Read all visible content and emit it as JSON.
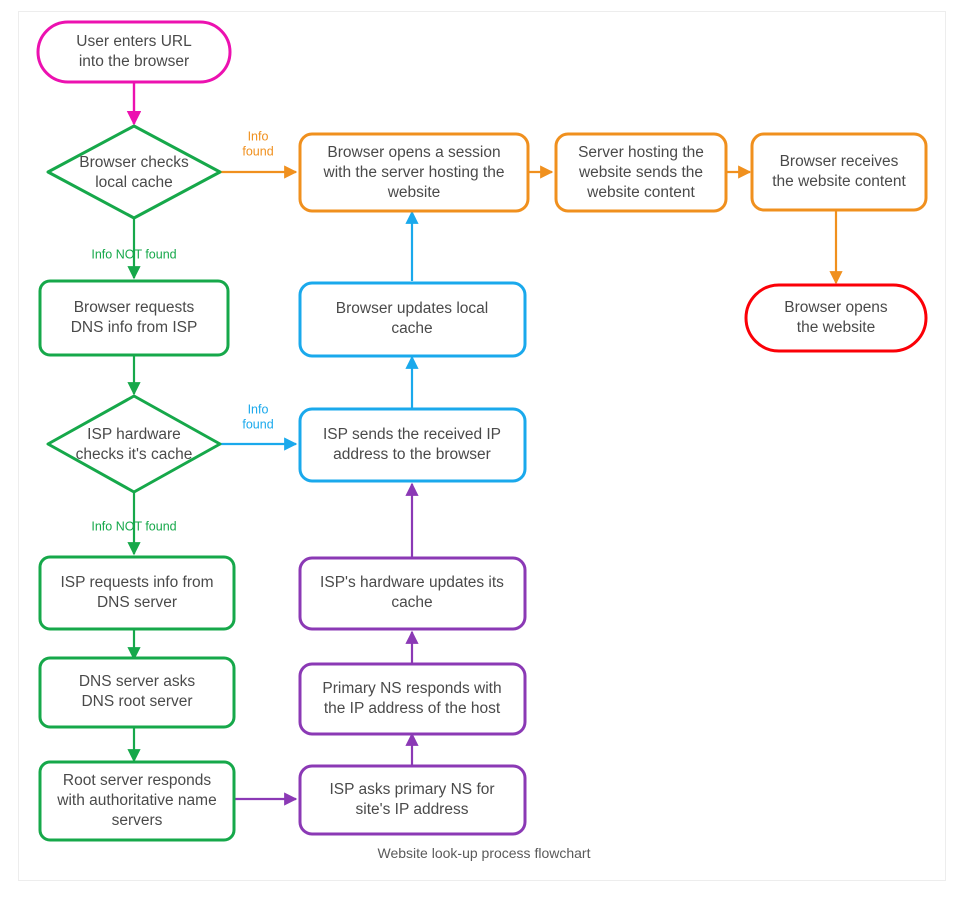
{
  "caption": "Website look-up process flowchart",
  "colors": {
    "start_pink": "#ec11b0",
    "decision_green": "#16a84a",
    "process_green": "#16a84a",
    "orange": "#f0901e",
    "blue": "#1aa9ec",
    "purple": "#8b39b5",
    "red": "#fb0007",
    "text": "#4a4a4a",
    "frame_border": "#ededed",
    "background": "#ffffff"
  },
  "nodes": [
    {
      "id": "start",
      "shape": "stadium",
      "color": "start_pink",
      "lines": [
        "User enters URL",
        "into the browser"
      ]
    },
    {
      "id": "browser-cache",
      "shape": "diamond",
      "color": "decision_green",
      "lines": [
        "Browser checks",
        "local cache"
      ]
    },
    {
      "id": "browser-dns",
      "shape": "rect",
      "color": "process_green",
      "lines": [
        "Browser requests",
        "DNS info from ISP"
      ]
    },
    {
      "id": "isp-cache",
      "shape": "diamond",
      "color": "decision_green",
      "lines": [
        "ISP hardware",
        "checks it's cache"
      ]
    },
    {
      "id": "isp-requests",
      "shape": "rect",
      "color": "process_green",
      "lines": [
        "ISP requests info from",
        "DNS server"
      ]
    },
    {
      "id": "dns-asks-root",
      "shape": "rect",
      "color": "process_green",
      "lines": [
        "DNS server asks",
        "DNS root server"
      ]
    },
    {
      "id": "root-responds",
      "shape": "rect",
      "color": "process_green",
      "lines": [
        "Root server responds",
        "with authoritative name",
        "servers"
      ]
    },
    {
      "id": "isp-asks-ns",
      "shape": "rect",
      "color": "purple",
      "lines": [
        "ISP asks primary NS for",
        "site's IP address"
      ]
    },
    {
      "id": "ns-responds",
      "shape": "rect",
      "color": "purple",
      "lines": [
        "Primary NS responds with",
        "the IP address of the host"
      ]
    },
    {
      "id": "isp-updates",
      "shape": "rect",
      "color": "purple",
      "lines": [
        "ISP's hardware updates its",
        "cache"
      ]
    },
    {
      "id": "isp-sends-ip",
      "shape": "rect",
      "color": "blue",
      "lines": [
        "ISP sends the received IP",
        "address to the browser"
      ]
    },
    {
      "id": "browser-updates",
      "shape": "rect",
      "color": "blue",
      "lines": [
        "Browser updates local",
        "cache"
      ]
    },
    {
      "id": "browser-session",
      "shape": "rect",
      "color": "orange",
      "lines": [
        "Browser opens a session",
        "with the server hosting the",
        "website"
      ]
    },
    {
      "id": "server-sends",
      "shape": "rect",
      "color": "orange",
      "lines": [
        "Server hosting the",
        "website sends the",
        "website content"
      ]
    },
    {
      "id": "browser-receives",
      "shape": "rect",
      "color": "orange",
      "lines": [
        "Browser receives",
        "the website content"
      ]
    },
    {
      "id": "browser-opens",
      "shape": "stadium",
      "color": "red",
      "lines": [
        "Browser opens",
        "the website"
      ]
    }
  ],
  "edges": [
    {
      "id": "start-to-cache",
      "color": "start_pink",
      "label": ""
    },
    {
      "id": "cache-found-to-session",
      "color": "orange",
      "label": "Info\nfound",
      "label_lines": [
        "Info",
        "found"
      ]
    },
    {
      "id": "cache-notfound-to-dns",
      "color": "process_green",
      "label": "Info NOT found",
      "label_lines": [
        "Info NOT found"
      ]
    },
    {
      "id": "dns-to-ispcache",
      "color": "process_green",
      "label": ""
    },
    {
      "id": "ispcache-found-to-sendsip",
      "color": "blue",
      "label": "Info\nfound",
      "label_lines": [
        "Info",
        "found"
      ]
    },
    {
      "id": "ispcache-notfound-to-isprequests",
      "color": "process_green",
      "label": "Info NOT found",
      "label_lines": [
        "Info NOT found"
      ]
    },
    {
      "id": "isprequests-to-dnsasks",
      "color": "process_green",
      "label": ""
    },
    {
      "id": "dnsasks-to-rootresponds",
      "color": "process_green",
      "label": ""
    },
    {
      "id": "rootresponds-to-ispasksns",
      "color": "purple",
      "label": ""
    },
    {
      "id": "ispasksns-to-nsresponds",
      "color": "purple",
      "label": ""
    },
    {
      "id": "nsresponds-to-ispupdates",
      "color": "purple",
      "label": ""
    },
    {
      "id": "ispupdates-to-sendsip",
      "color": "purple",
      "label": ""
    },
    {
      "id": "sendsip-to-browserupdates",
      "color": "blue",
      "label": ""
    },
    {
      "id": "browserupdates-to-session",
      "color": "blue",
      "label": ""
    },
    {
      "id": "session-to-serversends",
      "color": "orange",
      "label": ""
    },
    {
      "id": "serversends-to-receives",
      "color": "orange",
      "label": ""
    },
    {
      "id": "receives-to-opens",
      "color": "orange",
      "label": ""
    }
  ]
}
